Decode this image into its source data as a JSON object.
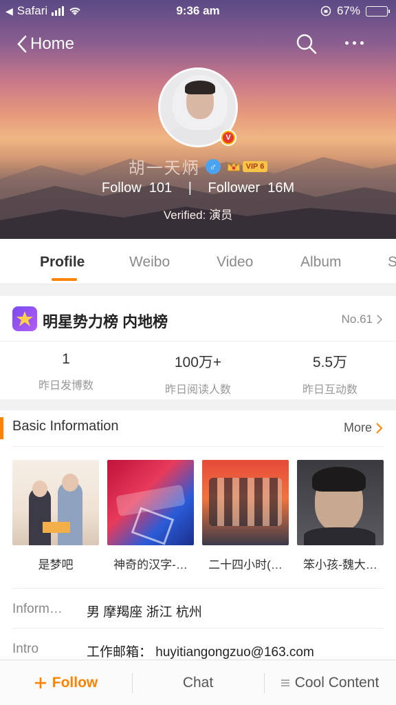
{
  "status_bar": {
    "carrier": "Safari",
    "time": "9:36 am",
    "battery_percent": "67%"
  },
  "nav": {
    "back_label": "Home"
  },
  "profile": {
    "name": "胡一天炳",
    "follow_label": "Follow",
    "follow_count": "101",
    "follower_label": "Follower",
    "follower_count": "16M",
    "verified_label": "Verified:",
    "verified_value": "演员",
    "vip_label": "VIP 6"
  },
  "tabs": [
    {
      "label": "Profile",
      "active": true
    },
    {
      "label": "Weibo",
      "active": false
    },
    {
      "label": "Video",
      "active": false
    },
    {
      "label": "Album",
      "active": false
    },
    {
      "label": "S",
      "active": false
    }
  ],
  "ranking": {
    "title": "明星势力榜 内地榜",
    "rank": "No.61",
    "stats": [
      {
        "value": "1",
        "label": "昨日发博数"
      },
      {
        "value": "100万+",
        "label": "昨日阅读人数"
      },
      {
        "value": "5.5万",
        "label": "昨日互动数"
      }
    ]
  },
  "basic_info": {
    "title": "Basic Information",
    "more_label": "More",
    "works": [
      {
        "caption": "是梦吧"
      },
      {
        "caption": "神奇的汉字-…"
      },
      {
        "caption": "二十四小时(…"
      },
      {
        "caption": "笨小孩-魏大…"
      }
    ],
    "rows": [
      {
        "key": "Inform…",
        "value": "男 摩羯座 浙江 杭州"
      },
      {
        "key": "Intro",
        "value": "工作邮箱： huyitiangongzuo@163.com"
      }
    ]
  },
  "bottom_bar": {
    "follow": "Follow",
    "chat": "Chat",
    "cool": "Cool Content"
  },
  "colors": {
    "accent": "#ff8200"
  }
}
